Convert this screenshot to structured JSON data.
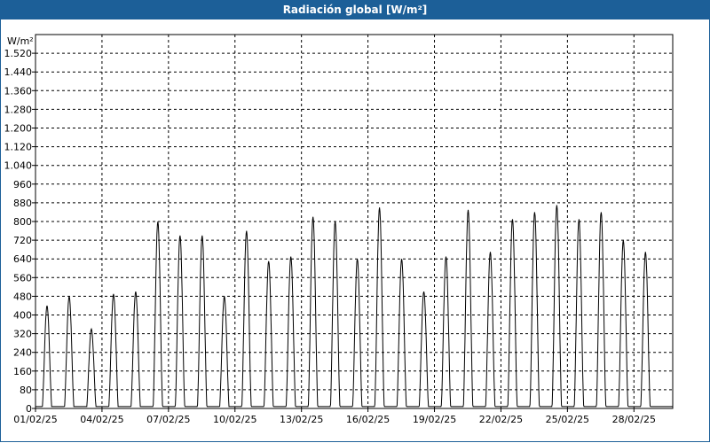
{
  "window": {
    "title": "Radiación global [W/m²]"
  },
  "colors": {
    "titlebar": "#1c5f98",
    "line": "#000000",
    "grid": "#000000"
  },
  "chart_data": {
    "type": "line",
    "title": "Radiación global [W/m²]",
    "ylabel": "W/m²",
    "xlabel": "",
    "ylim": [
      0,
      1600
    ],
    "xlim_days": [
      0,
      28.75
    ],
    "y_ticks": [
      "0",
      "80",
      "160",
      "240",
      "320",
      "400",
      "480",
      "560",
      "640",
      "720",
      "800",
      "880",
      "960",
      "1.040",
      "1.120",
      "1.200",
      "1.280",
      "1.360",
      "1.440",
      "1.520"
    ],
    "x_tick_labels": [
      "01/02/25",
      "04/02/25",
      "07/02/25",
      "10/02/25",
      "13/02/25",
      "16/02/25",
      "19/02/25",
      "22/02/25",
      "25/02/25",
      "28/02/25"
    ],
    "grid": true,
    "series": [
      {
        "daily_peak_w_m2": [
          440,
          480,
          340,
          490,
          500,
          800,
          740,
          740,
          480,
          760,
          630,
          650,
          820,
          800,
          640,
          860,
          640,
          500,
          650,
          850,
          670,
          810,
          840,
          870,
          810,
          840,
          720,
          670
        ]
      }
    ]
  }
}
